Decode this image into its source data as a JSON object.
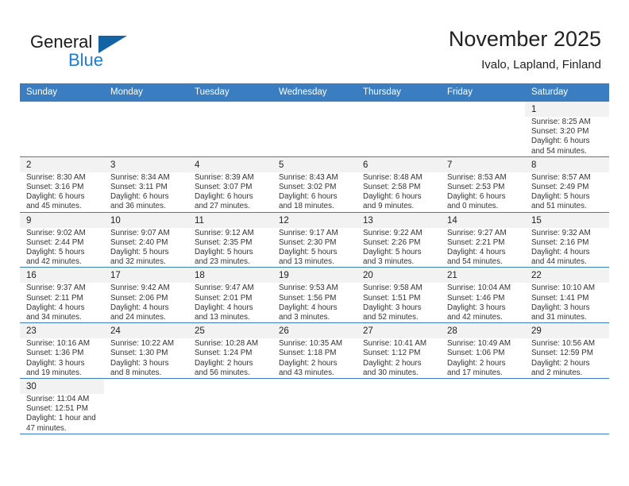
{
  "brand": {
    "word_one": "General",
    "word_two": "Blue",
    "triangle_icon": "brand-triangle-icon"
  },
  "header": {
    "month_title": "November 2025",
    "location": "Ivalo, Lapland, Finland"
  },
  "calendar": {
    "weekday_headers": [
      "Sunday",
      "Monday",
      "Tuesday",
      "Wednesday",
      "Thursday",
      "Friday",
      "Saturday"
    ],
    "accent_color": "#3a7dc0",
    "cell_fill_color": "#f2f2f2",
    "weeks": [
      [
        {
          "day": "",
          "sunrise": "",
          "sunset": "",
          "daylight": ""
        },
        {
          "day": "",
          "sunrise": "",
          "sunset": "",
          "daylight": ""
        },
        {
          "day": "",
          "sunrise": "",
          "sunset": "",
          "daylight": ""
        },
        {
          "day": "",
          "sunrise": "",
          "sunset": "",
          "daylight": ""
        },
        {
          "day": "",
          "sunrise": "",
          "sunset": "",
          "daylight": ""
        },
        {
          "day": "",
          "sunrise": "",
          "sunset": "",
          "daylight": ""
        },
        {
          "day": "1",
          "sunrise": "Sunrise: 8:25 AM",
          "sunset": "Sunset: 3:20 PM",
          "daylight": "Daylight: 6 hours and 54 minutes."
        }
      ],
      [
        {
          "day": "2",
          "sunrise": "Sunrise: 8:30 AM",
          "sunset": "Sunset: 3:16 PM",
          "daylight": "Daylight: 6 hours and 45 minutes."
        },
        {
          "day": "3",
          "sunrise": "Sunrise: 8:34 AM",
          "sunset": "Sunset: 3:11 PM",
          "daylight": "Daylight: 6 hours and 36 minutes."
        },
        {
          "day": "4",
          "sunrise": "Sunrise: 8:39 AM",
          "sunset": "Sunset: 3:07 PM",
          "daylight": "Daylight: 6 hours and 27 minutes."
        },
        {
          "day": "5",
          "sunrise": "Sunrise: 8:43 AM",
          "sunset": "Sunset: 3:02 PM",
          "daylight": "Daylight: 6 hours and 18 minutes."
        },
        {
          "day": "6",
          "sunrise": "Sunrise: 8:48 AM",
          "sunset": "Sunset: 2:58 PM",
          "daylight": "Daylight: 6 hours and 9 minutes."
        },
        {
          "day": "7",
          "sunrise": "Sunrise: 8:53 AM",
          "sunset": "Sunset: 2:53 PM",
          "daylight": "Daylight: 6 hours and 0 minutes."
        },
        {
          "day": "8",
          "sunrise": "Sunrise: 8:57 AM",
          "sunset": "Sunset: 2:49 PM",
          "daylight": "Daylight: 5 hours and 51 minutes."
        }
      ],
      [
        {
          "day": "9",
          "sunrise": "Sunrise: 9:02 AM",
          "sunset": "Sunset: 2:44 PM",
          "daylight": "Daylight: 5 hours and 42 minutes."
        },
        {
          "day": "10",
          "sunrise": "Sunrise: 9:07 AM",
          "sunset": "Sunset: 2:40 PM",
          "daylight": "Daylight: 5 hours and 32 minutes."
        },
        {
          "day": "11",
          "sunrise": "Sunrise: 9:12 AM",
          "sunset": "Sunset: 2:35 PM",
          "daylight": "Daylight: 5 hours and 23 minutes."
        },
        {
          "day": "12",
          "sunrise": "Sunrise: 9:17 AM",
          "sunset": "Sunset: 2:30 PM",
          "daylight": "Daylight: 5 hours and 13 minutes."
        },
        {
          "day": "13",
          "sunrise": "Sunrise: 9:22 AM",
          "sunset": "Sunset: 2:26 PM",
          "daylight": "Daylight: 5 hours and 3 minutes."
        },
        {
          "day": "14",
          "sunrise": "Sunrise: 9:27 AM",
          "sunset": "Sunset: 2:21 PM",
          "daylight": "Daylight: 4 hours and 54 minutes."
        },
        {
          "day": "15",
          "sunrise": "Sunrise: 9:32 AM",
          "sunset": "Sunset: 2:16 PM",
          "daylight": "Daylight: 4 hours and 44 minutes."
        }
      ],
      [
        {
          "day": "16",
          "sunrise": "Sunrise: 9:37 AM",
          "sunset": "Sunset: 2:11 PM",
          "daylight": "Daylight: 4 hours and 34 minutes."
        },
        {
          "day": "17",
          "sunrise": "Sunrise: 9:42 AM",
          "sunset": "Sunset: 2:06 PM",
          "daylight": "Daylight: 4 hours and 24 minutes."
        },
        {
          "day": "18",
          "sunrise": "Sunrise: 9:47 AM",
          "sunset": "Sunset: 2:01 PM",
          "daylight": "Daylight: 4 hours and 13 minutes."
        },
        {
          "day": "19",
          "sunrise": "Sunrise: 9:53 AM",
          "sunset": "Sunset: 1:56 PM",
          "daylight": "Daylight: 4 hours and 3 minutes."
        },
        {
          "day": "20",
          "sunrise": "Sunrise: 9:58 AM",
          "sunset": "Sunset: 1:51 PM",
          "daylight": "Daylight: 3 hours and 52 minutes."
        },
        {
          "day": "21",
          "sunrise": "Sunrise: 10:04 AM",
          "sunset": "Sunset: 1:46 PM",
          "daylight": "Daylight: 3 hours and 42 minutes."
        },
        {
          "day": "22",
          "sunrise": "Sunrise: 10:10 AM",
          "sunset": "Sunset: 1:41 PM",
          "daylight": "Daylight: 3 hours and 31 minutes."
        }
      ],
      [
        {
          "day": "23",
          "sunrise": "Sunrise: 10:16 AM",
          "sunset": "Sunset: 1:36 PM",
          "daylight": "Daylight: 3 hours and 19 minutes."
        },
        {
          "day": "24",
          "sunrise": "Sunrise: 10:22 AM",
          "sunset": "Sunset: 1:30 PM",
          "daylight": "Daylight: 3 hours and 8 minutes."
        },
        {
          "day": "25",
          "sunrise": "Sunrise: 10:28 AM",
          "sunset": "Sunset: 1:24 PM",
          "daylight": "Daylight: 2 hours and 56 minutes."
        },
        {
          "day": "26",
          "sunrise": "Sunrise: 10:35 AM",
          "sunset": "Sunset: 1:18 PM",
          "daylight": "Daylight: 2 hours and 43 minutes."
        },
        {
          "day": "27",
          "sunrise": "Sunrise: 10:41 AM",
          "sunset": "Sunset: 1:12 PM",
          "daylight": "Daylight: 2 hours and 30 minutes."
        },
        {
          "day": "28",
          "sunrise": "Sunrise: 10:49 AM",
          "sunset": "Sunset: 1:06 PM",
          "daylight": "Daylight: 2 hours and 17 minutes."
        },
        {
          "day": "29",
          "sunrise": "Sunrise: 10:56 AM",
          "sunset": "Sunset: 12:59 PM",
          "daylight": "Daylight: 2 hours and 2 minutes."
        }
      ],
      [
        {
          "day": "30",
          "sunrise": "Sunrise: 11:04 AM",
          "sunset": "Sunset: 12:51 PM",
          "daylight": "Daylight: 1 hour and 47 minutes."
        },
        {
          "day": "",
          "sunrise": "",
          "sunset": "",
          "daylight": ""
        },
        {
          "day": "",
          "sunrise": "",
          "sunset": "",
          "daylight": ""
        },
        {
          "day": "",
          "sunrise": "",
          "sunset": "",
          "daylight": ""
        },
        {
          "day": "",
          "sunrise": "",
          "sunset": "",
          "daylight": ""
        },
        {
          "day": "",
          "sunrise": "",
          "sunset": "",
          "daylight": ""
        },
        {
          "day": "",
          "sunrise": "",
          "sunset": "",
          "daylight": ""
        }
      ]
    ]
  }
}
